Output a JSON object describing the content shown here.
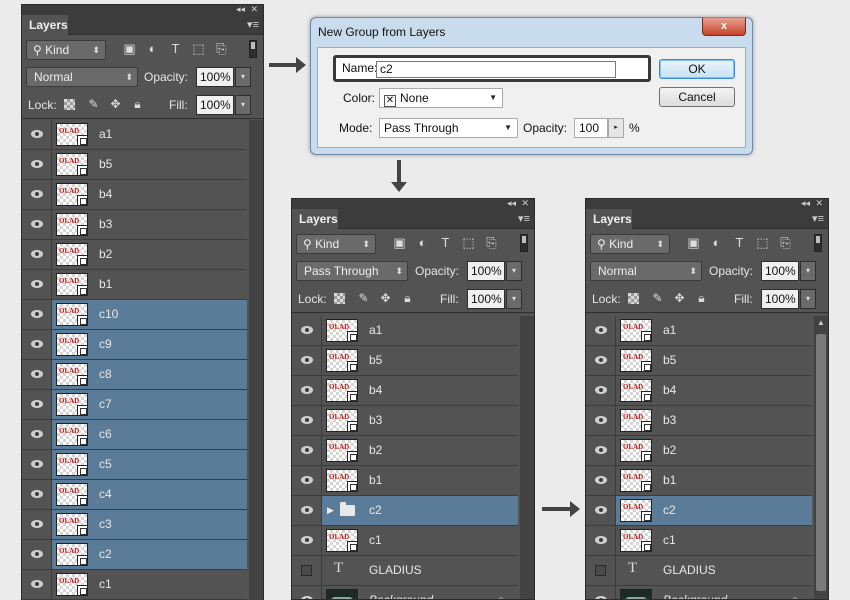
{
  "panel_common": {
    "tab": "Layers",
    "kind": "Kind",
    "opacity_label": "Opacity:",
    "opacity_value": "100%",
    "lock_label": "Lock:",
    "fill_label": "Fill:",
    "fill_value": "100%"
  },
  "panel_left": {
    "blend_mode": "Normal",
    "layers": [
      {
        "name": "a1",
        "selected": false
      },
      {
        "name": "b5",
        "selected": false
      },
      {
        "name": "b4",
        "selected": false
      },
      {
        "name": "b3",
        "selected": false
      },
      {
        "name": "b2",
        "selected": false
      },
      {
        "name": "b1",
        "selected": false
      },
      {
        "name": "c10",
        "selected": true
      },
      {
        "name": "c9",
        "selected": true
      },
      {
        "name": "c8",
        "selected": true
      },
      {
        "name": "c7",
        "selected": true
      },
      {
        "name": "c6",
        "selected": true
      },
      {
        "name": "c5",
        "selected": true
      },
      {
        "name": "c4",
        "selected": true
      },
      {
        "name": "c3",
        "selected": true
      },
      {
        "name": "c2",
        "selected": true
      },
      {
        "name": "c1",
        "selected": false
      }
    ]
  },
  "panel_mid": {
    "blend_mode": "Pass Through",
    "layers": [
      {
        "name": "a1"
      },
      {
        "name": "b5"
      },
      {
        "name": "b4"
      },
      {
        "name": "b3"
      },
      {
        "name": "b2"
      },
      {
        "name": "b1"
      },
      {
        "name": "c2",
        "group": true,
        "selected": true
      },
      {
        "name": "c1"
      },
      {
        "name": "GLADIUS",
        "text": true
      },
      {
        "name": "Background",
        "background": true
      }
    ]
  },
  "panel_right": {
    "blend_mode": "Normal",
    "layers": [
      {
        "name": "a1"
      },
      {
        "name": "b5"
      },
      {
        "name": "b4"
      },
      {
        "name": "b3"
      },
      {
        "name": "b2"
      },
      {
        "name": "b1"
      },
      {
        "name": "c2",
        "selected": true
      },
      {
        "name": "c1"
      },
      {
        "name": "GLADIUS",
        "text": true
      },
      {
        "name": "Background",
        "background": true
      }
    ]
  },
  "thumb_text": "OLAD",
  "dialog": {
    "title": "New Group from Layers",
    "name_label": "Name:",
    "name_value": "c2",
    "color_label": "Color:",
    "color_value": "None",
    "mode_label": "Mode:",
    "mode_value": "Pass Through",
    "opacity_label": "Opacity:",
    "opacity_value": "100",
    "percent": "%",
    "ok": "OK",
    "cancel": "Cancel",
    "close_glyph": "x"
  },
  "colors": {
    "panel_bg": "#535353",
    "selected_row": "#5b7c98",
    "dialog_frame": "#c8dcee"
  }
}
